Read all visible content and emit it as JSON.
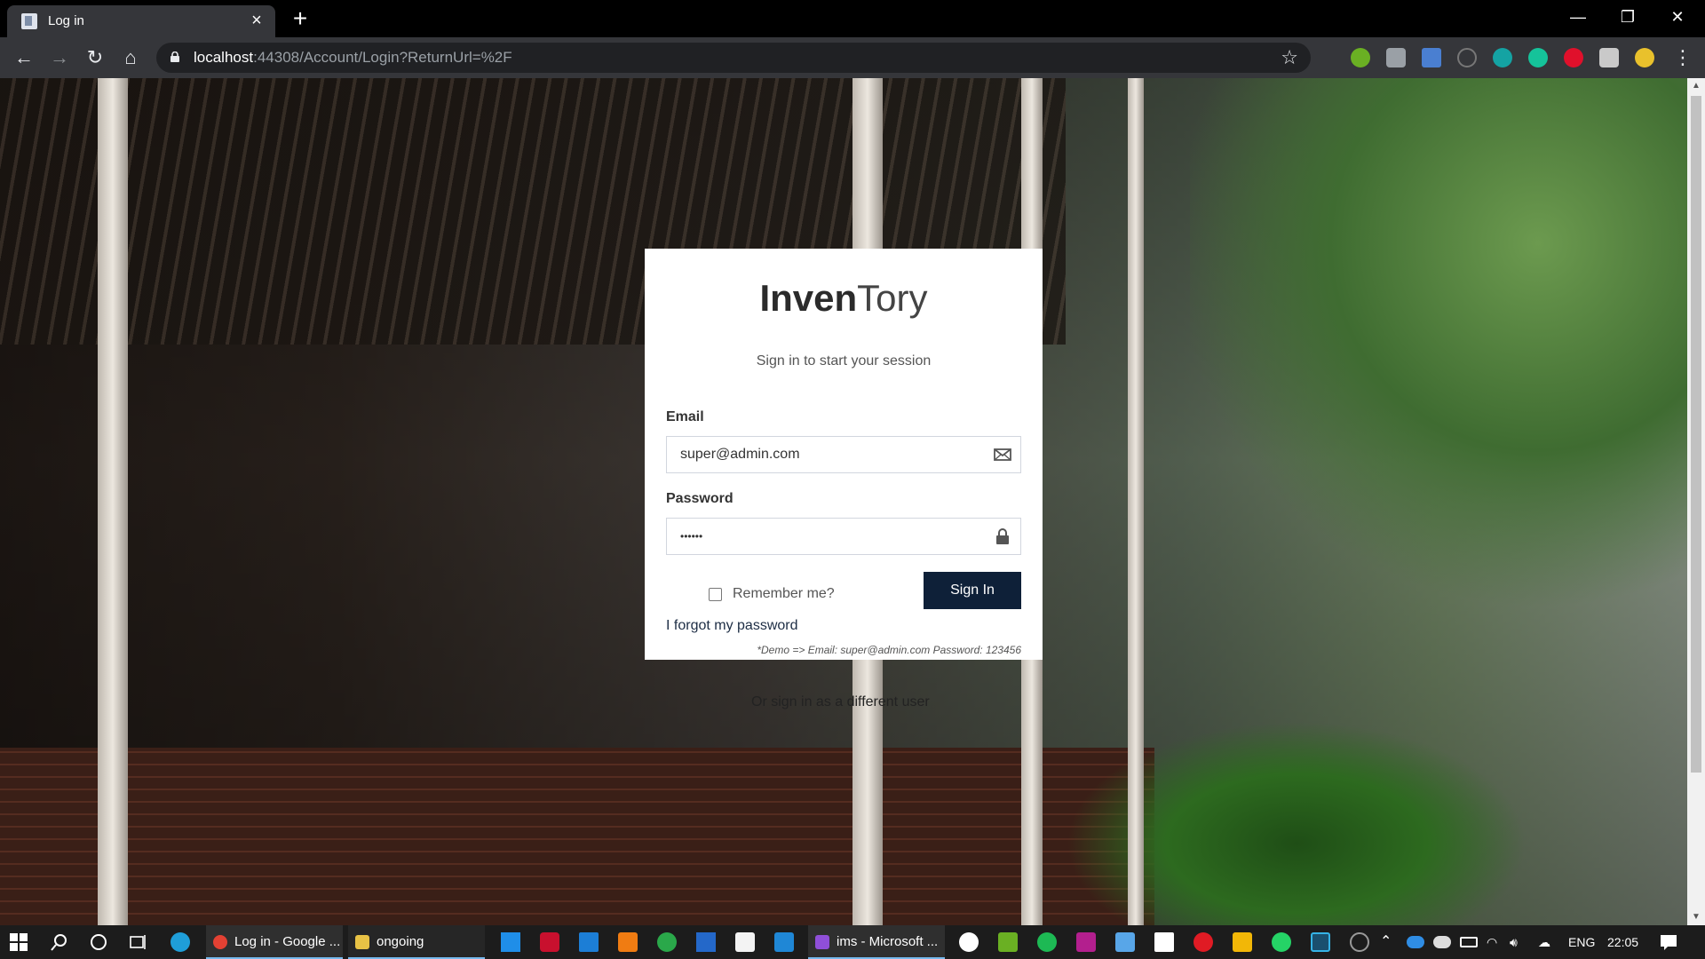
{
  "browser": {
    "tab_title": "Log in",
    "tab_close": "×",
    "new_tab": "+",
    "url_host": "localhost",
    "url_path": ":44308/Account/Login?ReturnUrl=%2F",
    "window_minimize": "—",
    "window_restore": "❐",
    "window_close": "✕",
    "back": "←",
    "forward": "→",
    "reload": "↻",
    "home": "⌂",
    "bookmark_star": "☆"
  },
  "login": {
    "brand_bold": "Inven",
    "brand_light": "Tory",
    "message": "Sign in to start your session",
    "email_label": "Email",
    "email_value": "super@admin.com",
    "password_label": "Password",
    "password_value": "••••••",
    "remember_label": "Remember me?",
    "signin_label": "Sign In",
    "forgot_label": "I forgot my password",
    "demo_note": "*Demo => Email: super@admin.com Password: 123456",
    "alt_user": "Or sign in as a different user"
  },
  "taskbar": {
    "chrome_app": "Log in - Google ...",
    "folder_app": "ongoing",
    "vs_app": "ims - Microsoft ...",
    "language": "ENG",
    "time": "22:05"
  },
  "colors": {
    "signin_button": "#0e2038",
    "chrome_dark": "#35363a",
    "taskbar": "#1c1c1c"
  }
}
